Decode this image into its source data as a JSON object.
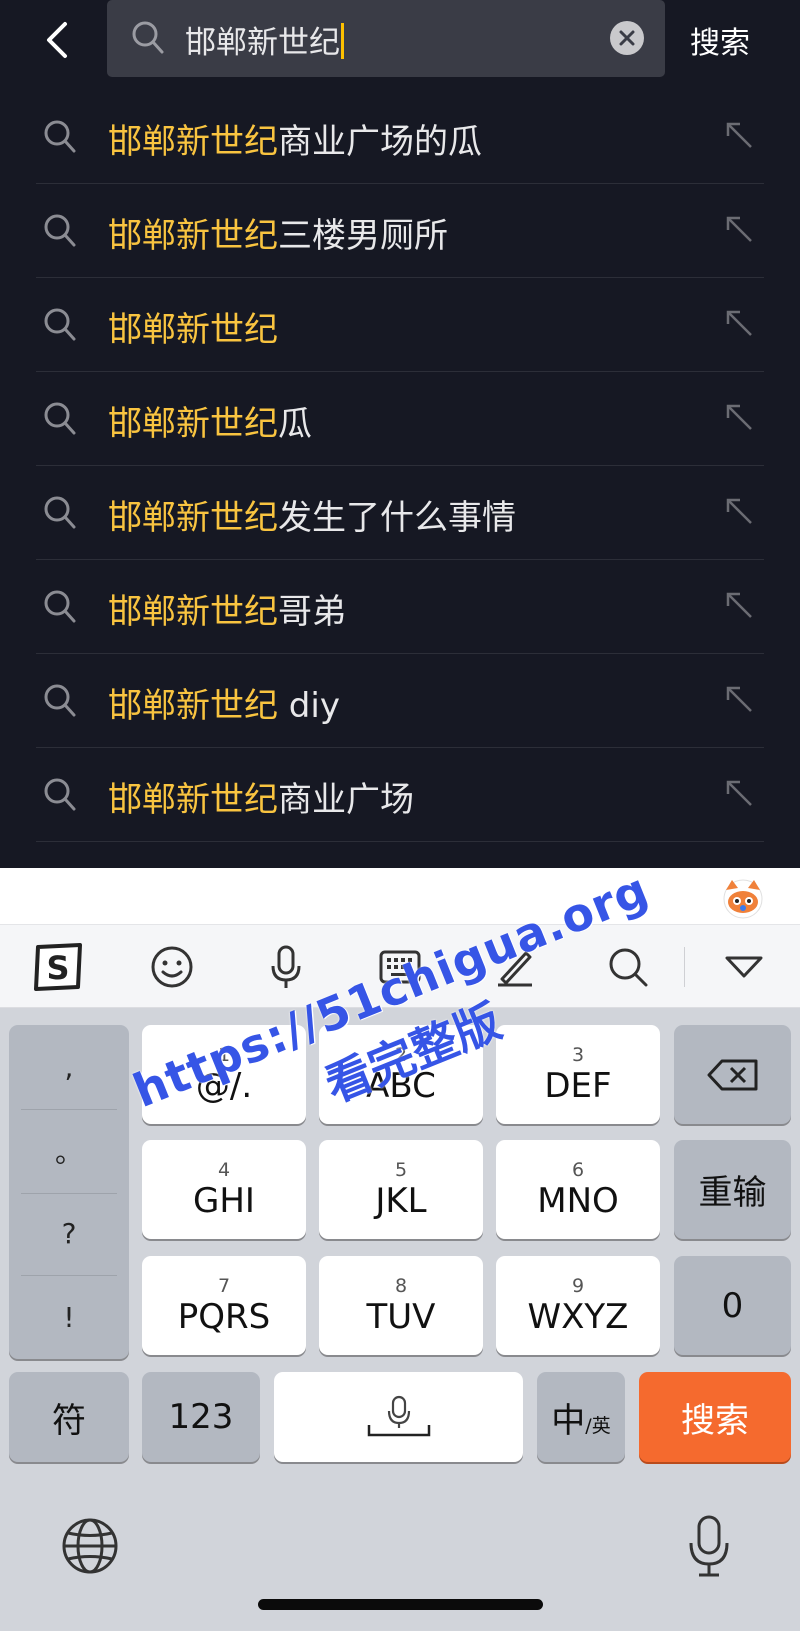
{
  "header": {
    "query": "邯郸新世纪",
    "search_label": "搜索"
  },
  "suggestions": [
    {
      "highlight": "邯郸新世纪",
      "rest": "商业广场的瓜"
    },
    {
      "highlight": "邯郸新世纪",
      "rest": "三楼男厕所"
    },
    {
      "highlight": "邯郸新世纪",
      "rest": ""
    },
    {
      "highlight": "邯郸新世纪",
      "rest": "瓜"
    },
    {
      "highlight": "邯郸新世纪",
      "rest": "发生了什么事情"
    },
    {
      "highlight": "邯郸新世纪",
      "rest": "哥弟"
    },
    {
      "highlight": "邯郸新世纪",
      "rest": " diy"
    },
    {
      "highlight": "邯郸新世纪",
      "rest": "商业广场"
    }
  ],
  "colors": {
    "background": "#161823",
    "highlight": "#f9c440",
    "accent_key": "#f56a2e"
  },
  "keyboard": {
    "toolbar_icons": [
      "sogou-logo-icon",
      "emoji-icon",
      "voice-icon",
      "keyboard-icon",
      "handwriting-icon",
      "search-icon",
      "collapse-icon"
    ],
    "punct": [
      ",",
      "。",
      "?",
      "!"
    ],
    "keys": {
      "k1": {
        "num": "1",
        "label": "@/."
      },
      "k2": {
        "num": "2",
        "label": "ABC"
      },
      "k3": {
        "num": "3",
        "label": "DEF"
      },
      "k4": {
        "num": "4",
        "label": "GHI"
      },
      "k5": {
        "num": "5",
        "label": "JKL"
      },
      "k6": {
        "num": "6",
        "label": "MNO"
      },
      "k7": {
        "num": "7",
        "label": "PQRS"
      },
      "k8": {
        "num": "8",
        "label": "TUV"
      },
      "k9": {
        "num": "9",
        "label": "WXYZ"
      }
    },
    "retype_label": "重输",
    "zero_label": "0",
    "symbol_label": "符",
    "num_label": "123",
    "zh_label": "中",
    "en_label": "/英",
    "go_label": "搜索"
  },
  "watermark": {
    "url": "https://51chigua.org",
    "sub": "看完整版"
  }
}
